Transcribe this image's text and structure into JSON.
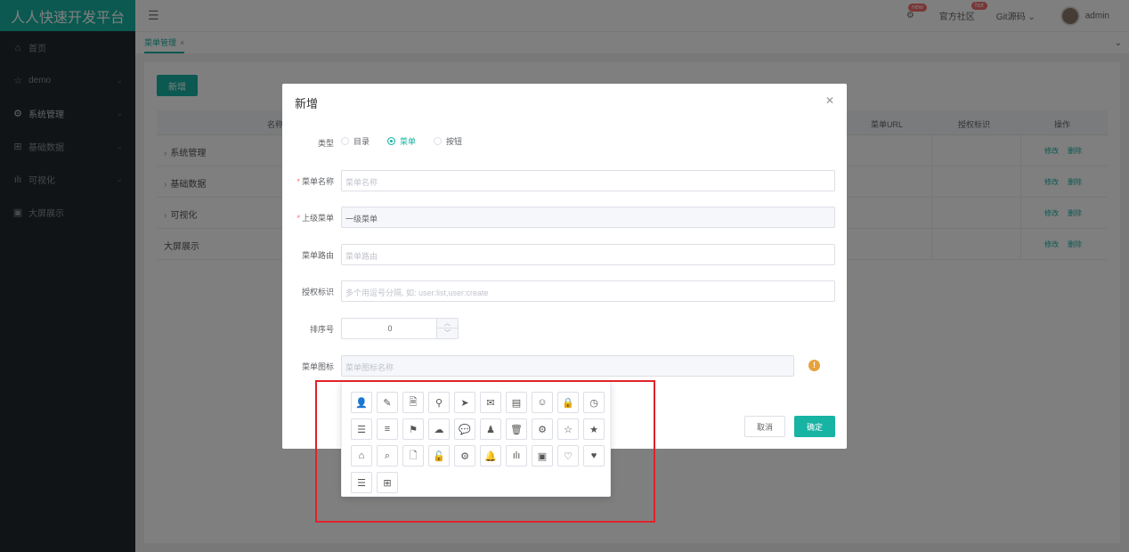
{
  "app": {
    "title": "人人快速开发平台"
  },
  "sidebar": {
    "items": [
      {
        "label": "首页",
        "icon": "home-icon",
        "glyph": "⌂",
        "has_children": false
      },
      {
        "label": "demo",
        "icon": "star-icon",
        "glyph": "☆",
        "has_children": true
      },
      {
        "label": "系统管理",
        "icon": "gear-icon",
        "glyph": "⚙",
        "has_children": true
      },
      {
        "label": "基础数据",
        "icon": "grid-icon",
        "glyph": "⊞",
        "has_children": true
      },
      {
        "label": "可视化",
        "icon": "bar-chart-icon",
        "glyph": "ılı",
        "has_children": true
      },
      {
        "label": "大屏展示",
        "icon": "monitor-icon",
        "glyph": "▣",
        "has_children": false
      }
    ]
  },
  "header": {
    "menu_toggle_icon": "hamburger-icon",
    "notification_badge": "new",
    "community_label": "官方社区",
    "community_badge": "hot",
    "git_label": "Git源码",
    "user_name": "admin"
  },
  "tabs": [
    {
      "label": "菜单管理"
    }
  ],
  "main": {
    "new_button": "新增",
    "columns": [
      "名称",
      "菜单URL",
      "授权标识",
      "操作"
    ],
    "rows": [
      {
        "name": "系统管理",
        "expandable": true,
        "edit": "修改",
        "delete": "删除"
      },
      {
        "name": "基础数据",
        "expandable": true,
        "edit": "修改",
        "delete": "删除"
      },
      {
        "name": "可视化",
        "expandable": true,
        "edit": "修改",
        "delete": "删除"
      },
      {
        "name": "大屏展示",
        "expandable": false,
        "edit": "修改",
        "delete": "删除"
      }
    ]
  },
  "dialog": {
    "title": "新增",
    "type_label": "类型",
    "type_options": [
      {
        "label": "目录",
        "selected": false
      },
      {
        "label": "菜单",
        "selected": true
      },
      {
        "label": "按钮",
        "selected": false
      }
    ],
    "name_label": "菜单名称",
    "name_placeholder": "菜单名称",
    "parent_label": "上级菜单",
    "parent_value": "一级菜单",
    "route_label": "菜单路由",
    "route_placeholder": "菜单路由",
    "perm_label": "授权标识",
    "perm_placeholder": "多个用逗号分隔, 如: user:list,user:create",
    "sort_label": "排序号",
    "sort_value": "0",
    "icon_label": "菜单图标",
    "icon_placeholder": "菜单图标名称",
    "cancel_label": "取消",
    "ok_label": "确定"
  },
  "icon_picker": {
    "icons": [
      {
        "name": "user-icon",
        "glyph": "👤"
      },
      {
        "name": "edit-icon",
        "glyph": "✎"
      },
      {
        "name": "document-add-icon",
        "glyph": "🗎"
      },
      {
        "name": "location-icon",
        "glyph": "⚲"
      },
      {
        "name": "send-icon",
        "glyph": "➤"
      },
      {
        "name": "mail-icon",
        "glyph": "✉"
      },
      {
        "name": "news-icon",
        "glyph": "▤"
      },
      {
        "name": "contact-icon",
        "glyph": "☺"
      },
      {
        "name": "lock-icon",
        "glyph": "🔒"
      },
      {
        "name": "time-icon",
        "glyph": "◷"
      },
      {
        "name": "document-icon",
        "glyph": "☰"
      },
      {
        "name": "list-icon",
        "glyph": "≡"
      },
      {
        "name": "signpost-icon",
        "glyph": "⚑"
      },
      {
        "name": "upload-icon",
        "glyph": "☁"
      },
      {
        "name": "chat-icon",
        "glyph": "💬"
      },
      {
        "name": "user-solid-icon",
        "glyph": "♟"
      },
      {
        "name": "delete-icon",
        "glyph": "🗑"
      },
      {
        "name": "settings-icon",
        "glyph": "⚙"
      },
      {
        "name": "star-outline-icon",
        "glyph": "☆"
      },
      {
        "name": "star-solid-icon",
        "glyph": "★"
      },
      {
        "name": "home-icon",
        "glyph": "⌂"
      },
      {
        "name": "search-icon",
        "glyph": "⌕"
      },
      {
        "name": "tickets-icon",
        "glyph": "🗋"
      },
      {
        "name": "unlock-icon",
        "glyph": "🔓"
      },
      {
        "name": "setting-icon",
        "glyph": "⚙"
      },
      {
        "name": "bell-icon",
        "glyph": "🔔"
      },
      {
        "name": "data-analysis-icon",
        "glyph": "ılı"
      },
      {
        "name": "monitor-icon",
        "glyph": "▣"
      },
      {
        "name": "heart-outline-icon",
        "glyph": "♡"
      },
      {
        "name": "heart-solid-icon",
        "glyph": "♥"
      },
      {
        "name": "menu-icon",
        "glyph": "☰"
      },
      {
        "name": "grid-icon",
        "glyph": "⊞"
      }
    ]
  },
  "colors": {
    "accent": "#17b3a3",
    "sidebar_bg": "#22292d",
    "danger": "#f56c6c",
    "warning": "#e6a23c",
    "highlight_box": "#e0222a"
  }
}
